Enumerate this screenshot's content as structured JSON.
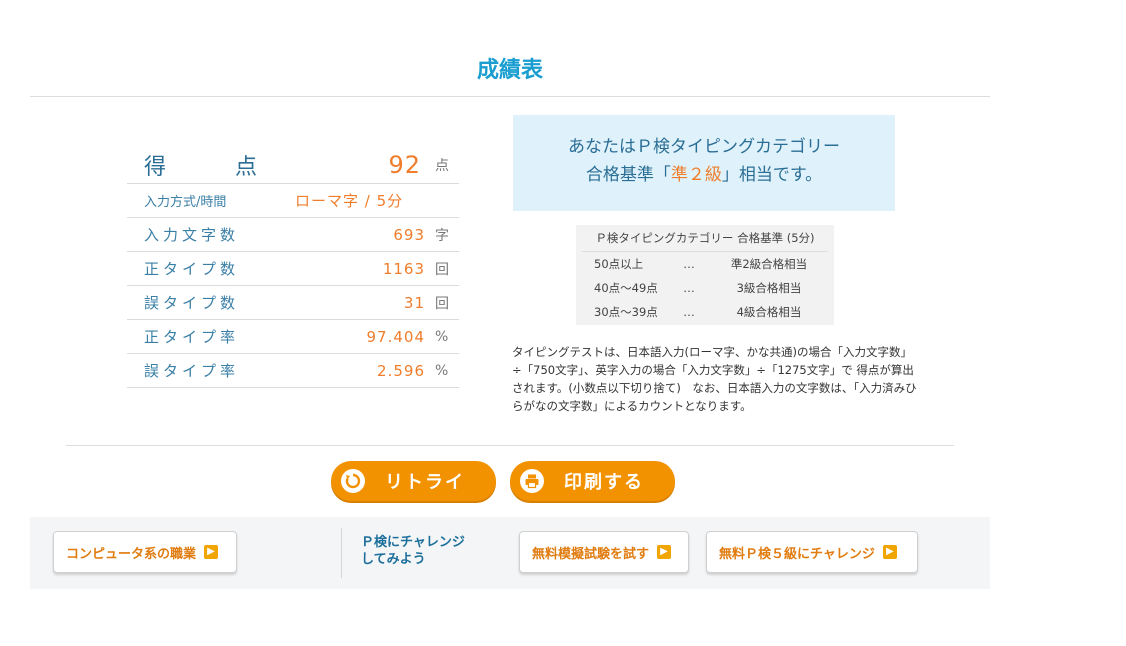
{
  "title": "成績表",
  "score": {
    "label_chars": [
      "得",
      "点"
    ],
    "value": "92",
    "unit": "点"
  },
  "rows": [
    {
      "label": "入力方式/時間",
      "value": "ローマ字 / 5分",
      "unit": ""
    },
    {
      "label": "入力文字数",
      "value": "693",
      "unit": "字"
    },
    {
      "label": "正タイプ数",
      "value": "1163",
      "unit": "回"
    },
    {
      "label": "誤タイプ数",
      "value": "31",
      "unit": "回"
    },
    {
      "label": "正タイプ率",
      "value": "97.404",
      "unit": "%"
    },
    {
      "label": "誤タイプ率",
      "value": "2.596",
      "unit": "%"
    }
  ],
  "result": {
    "line1": "あなたはＰ検タイピングカテゴリー",
    "line2_pre": "合格基準「",
    "line2_grade": "準２級",
    "line2_post": "」相当です。"
  },
  "criteria": {
    "title": "Ｐ検タイピングカテゴリー 合格基準 (5分)",
    "rows": [
      {
        "range": "50点以上",
        "sep": "…",
        "grade": "準2級合格相当"
      },
      {
        "range": "40点～49点",
        "sep": "…",
        "grade": "3級合格相当"
      },
      {
        "range": "30点～39点",
        "sep": "…",
        "grade": "4級合格相当"
      }
    ]
  },
  "note": "タイピングテストは、日本語入力(ローマ字、かな共通)の場合「入力文字数」÷「750文字」、英字入力の場合「入力文字数」÷「1275文字」で 得点が算出されます。(小数点以下切り捨て)　なお、日本語入力の文字数は、「入力済みひらがなの文字数」によるカウントとなります。",
  "buttons": {
    "retry": "リトライ",
    "print": "印刷する"
  },
  "footer": {
    "jobs": "コンピュータ系の職業",
    "challenge_line1": "Ｐ検にチャレンジ",
    "challenge_line2": "してみよう",
    "mock_exam": "無料模擬試験を試す",
    "grade5": "無料Ｐ検５級にチャレンジ"
  },
  "colors": {
    "accent_blue": "#1a9ed0",
    "accent_orange": "#ef7d2c",
    "button_orange": "#f39200"
  }
}
